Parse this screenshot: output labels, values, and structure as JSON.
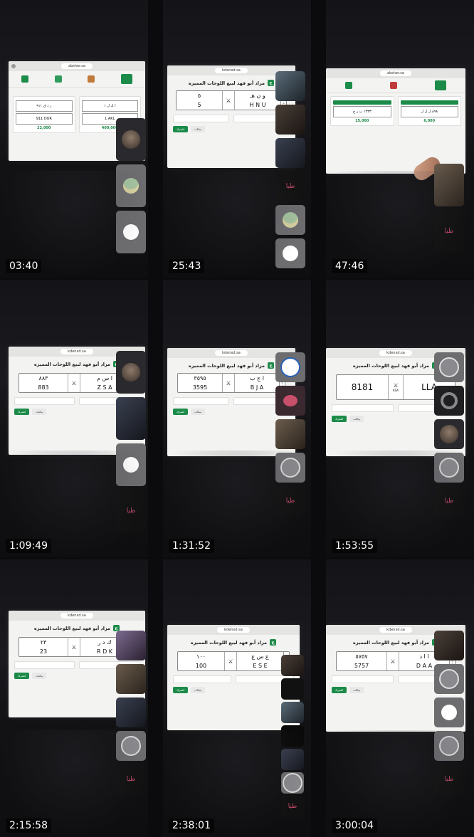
{
  "timestamps": [
    "03:40",
    "25:43",
    "47:46",
    "1:09:49",
    "1:31:52",
    "1:53:55",
    "2:15:58",
    "2:38:01",
    "3:00:04"
  ],
  "site": {
    "url_absher": "absher.sa",
    "url_auction": "kdenxd.sa",
    "page_title": "مزاد أبو فهد لبيع اللوحات المميزه",
    "logo_glyph": "ج",
    "submit_label": "اشترك",
    "secondary_label": "بيانات"
  },
  "absher": {
    "cards": [
      {
        "plate_ar": "ر د ق  ٩١١",
        "plate_en": "911  DUR",
        "price": "22,000"
      },
      {
        "plate_ar": "ا ك ل  ١",
        "plate_en": "1  AKL",
        "price": "400,000"
      }
    ],
    "cards2": [
      {
        "plate_ar": "١٣٣٣  ب ر ح",
        "plate_en": "1333",
        "price": "15,000"
      },
      {
        "plate_ar": "٨٩٨  ل ل ل",
        "plate_en": "898  ALL",
        "price": "6,000"
      }
    ]
  },
  "plates": [
    {
      "ar_num": "٥",
      "ar_letters": "و ن هـ",
      "en_num": "5",
      "en_letters": "H N U"
    },
    {
      "ar_num": "٨٨٣",
      "ar_letters": "ا س م",
      "en_num": "883",
      "en_letters": "Z S A"
    },
    {
      "ar_num": "٣٥٩٥",
      "ar_letters": "ا ج ب",
      "en_num": "3595",
      "en_letters": "B J A"
    },
    {
      "ar_num": "8181",
      "ar_letters": "LLA",
      "en_num": "",
      "en_letters": "KSA"
    },
    {
      "ar_num": "٢٣",
      "ar_letters": "ك د ر",
      "en_num": "23",
      "en_letters": "R D K"
    },
    {
      "ar_num": "١٠٠",
      "ar_letters": "ع س ع",
      "en_num": "100",
      "en_letters": "E S E"
    },
    {
      "ar_num": "٥٧٥٧",
      "ar_letters": "ا ا د",
      "en_num": "5757",
      "en_letters": "D A A"
    }
  ],
  "sidebar_logo_text": "طيا"
}
